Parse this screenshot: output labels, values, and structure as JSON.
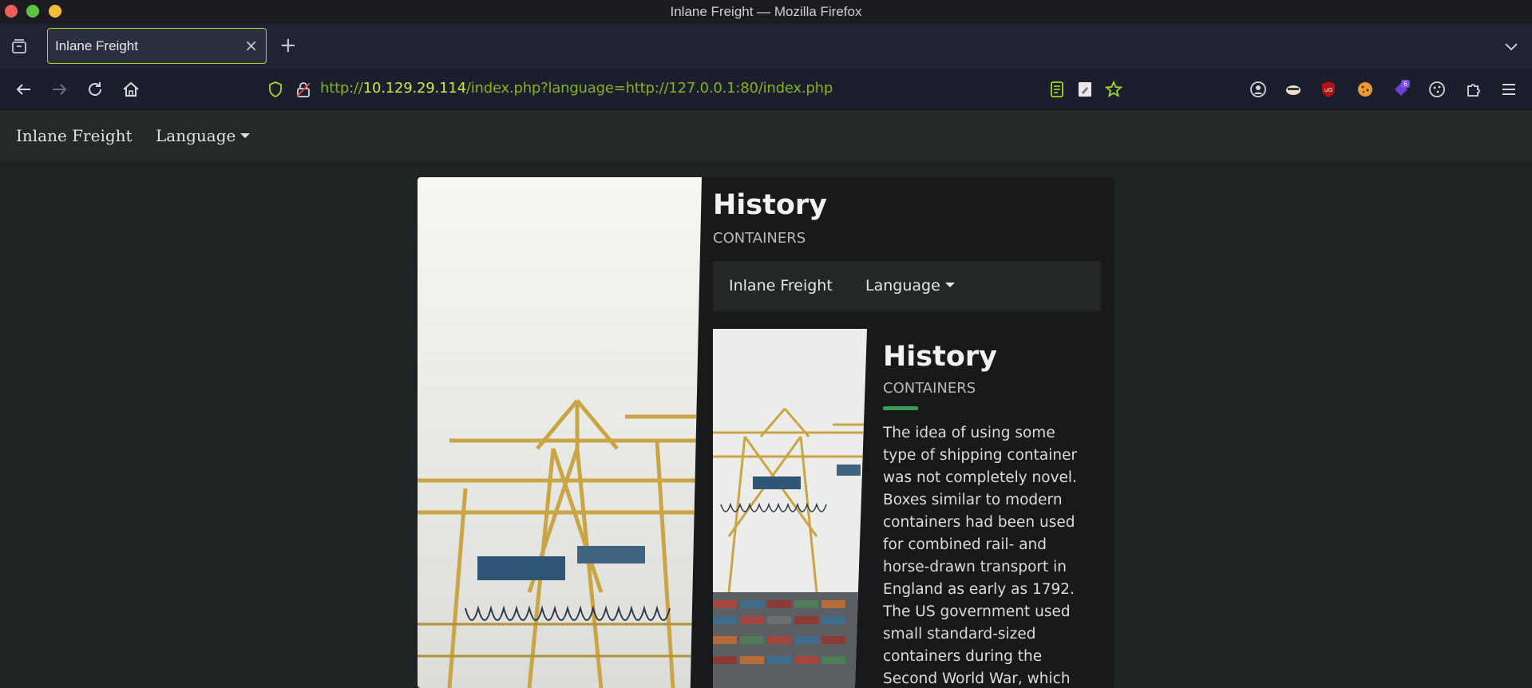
{
  "window": {
    "title": "Inlane Freight — Mozilla Firefox"
  },
  "tab": {
    "label": "Inlane Freight",
    "close_glyph": "×",
    "new_tab_glyph": "+"
  },
  "urlbar": {
    "scheme": "http://",
    "host": "10.129.29.114",
    "path": "/index.php?language=http://127.0.0.1:80/index.php"
  },
  "extensions": {
    "badge_count": "6"
  },
  "site_nav": {
    "brand": "Inlane Freight",
    "language": "Language"
  },
  "card": {
    "title": "History",
    "subtitle": "CONTAINERS",
    "inner_nav": {
      "brand": "Inlane Freight",
      "language": "Language"
    },
    "inner": {
      "title": "History",
      "subtitle": "CONTAINERS",
      "paragraph": "The idea of using some type of shipping container was not completely novel. Boxes similar to modern containers had been used for combined rail- and horse-drawn transport in England as early as 1792. The US government used small standard-sized containers during the Second World War, which"
    }
  },
  "colors": {
    "accent": "#a8d422",
    "url_green": "#87b11c",
    "underline": "#3c9a55"
  }
}
